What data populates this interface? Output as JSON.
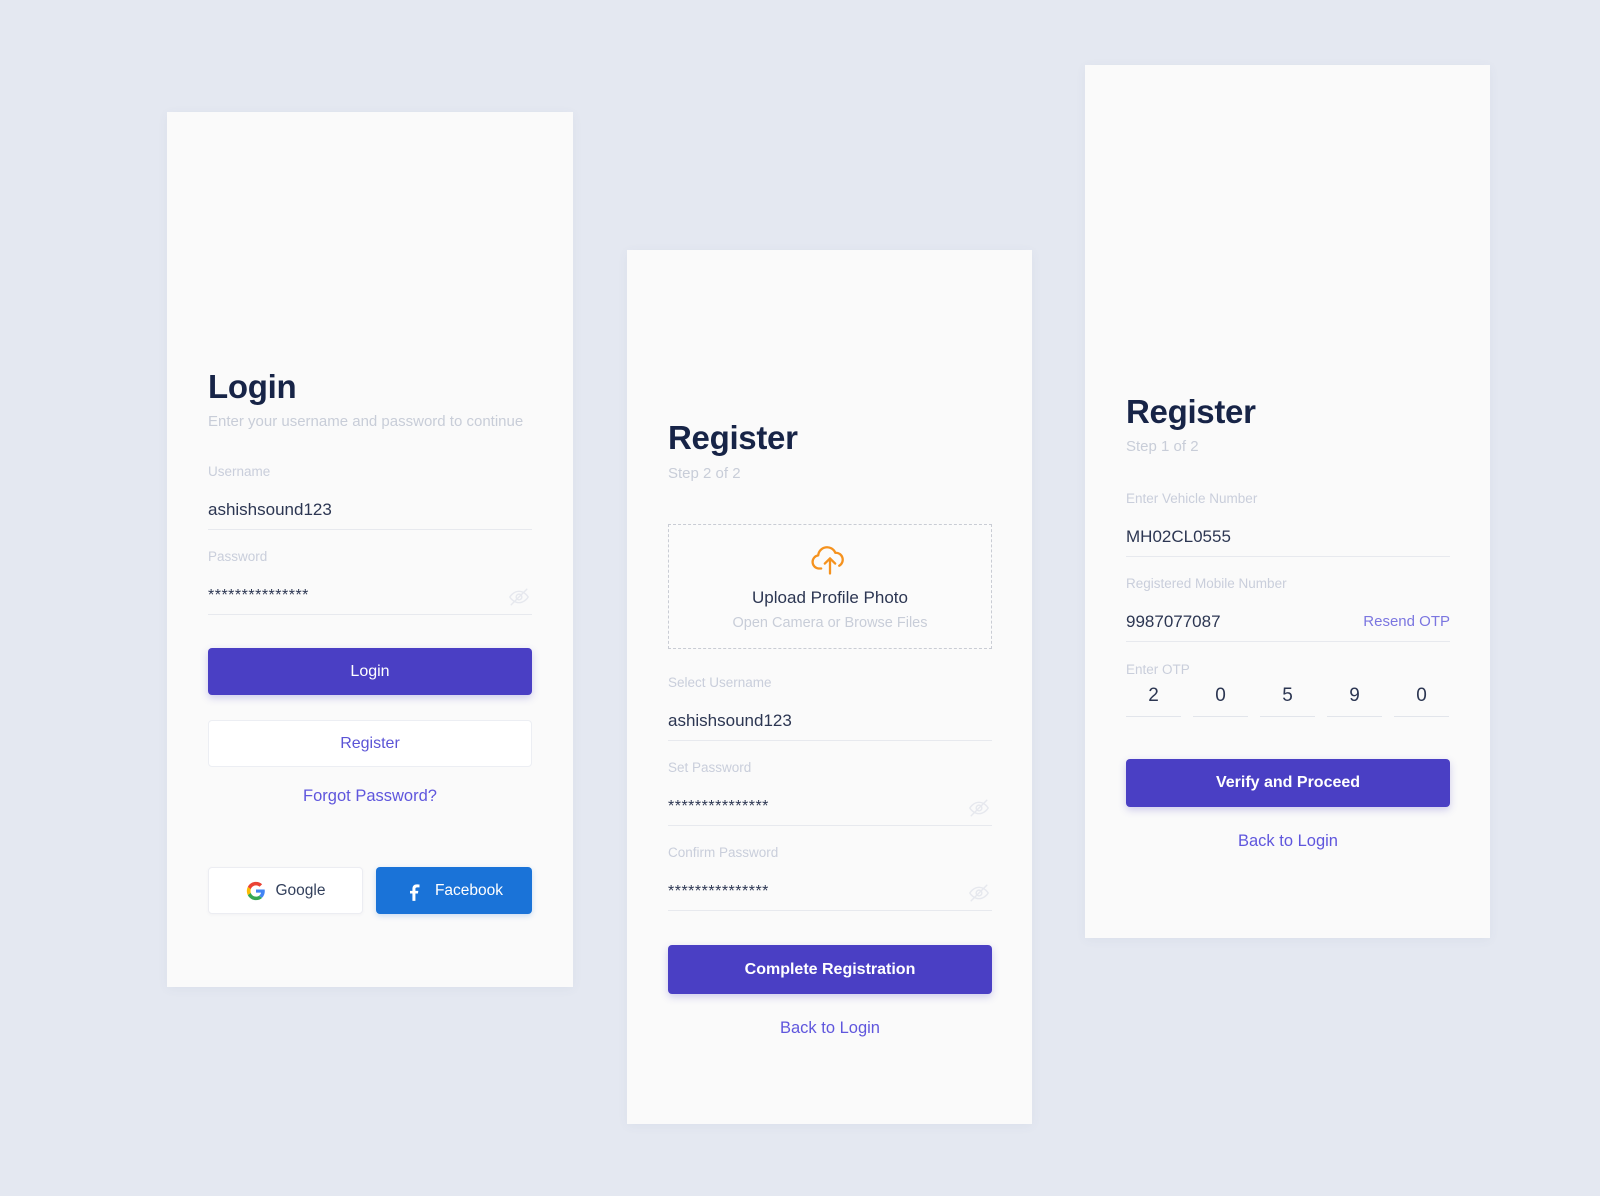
{
  "theme": {
    "page_background": "#e4e8f1",
    "card_background": "#fafafa",
    "primary": "#4a3fc4",
    "link": "#5f56dd",
    "accent_orange": "#f5921e",
    "facebook_blue": "#1a73d8",
    "heading": "#172447",
    "muted_label": "#c9cedb"
  },
  "login_card": {
    "title": "Login",
    "subtitle": "Enter your username and password to continue",
    "username": {
      "label": "Username",
      "value": "ashishsound123"
    },
    "password": {
      "label": "Password",
      "value": "***************",
      "toggle_icon": "eye-off-icon"
    },
    "primary_button": "Login",
    "secondary_button": "Register",
    "forgot_link": "Forgot Password?",
    "social": {
      "google_label": "Google",
      "google_icon": "google-g-icon",
      "facebook_label": "Facebook",
      "facebook_icon": "facebook-f-icon"
    }
  },
  "register_step2_card": {
    "title": "Register",
    "step": "Step 2 of 2",
    "upload": {
      "icon": "cloud-upload-icon",
      "title": "Upload Profile Photo",
      "subtitle": "Open Camera or Browse Files"
    },
    "username": {
      "label": "Select Username",
      "value": "ashishsound123"
    },
    "set_password": {
      "label": "Set Password",
      "value": "***************",
      "toggle_icon": "eye-off-icon"
    },
    "confirm_password": {
      "label": "Confirm Password",
      "value": "***************",
      "toggle_icon": "eye-off-icon"
    },
    "primary_button": "Complete Registration",
    "back_link": "Back to Login"
  },
  "register_step1_card": {
    "title": "Register",
    "step": "Step 1 of 2",
    "vehicle": {
      "label": "Enter Vehicle Number",
      "value": "MH02CL0555"
    },
    "mobile": {
      "label": "Registered Mobile Number",
      "value": "9987077087",
      "resend_link": "Resend OTP"
    },
    "otp": {
      "label": "Enter OTP",
      "digits": [
        "2",
        "0",
        "5",
        "9",
        "0"
      ]
    },
    "primary_button": "Verify and Proceed",
    "back_link": "Back to Login"
  }
}
